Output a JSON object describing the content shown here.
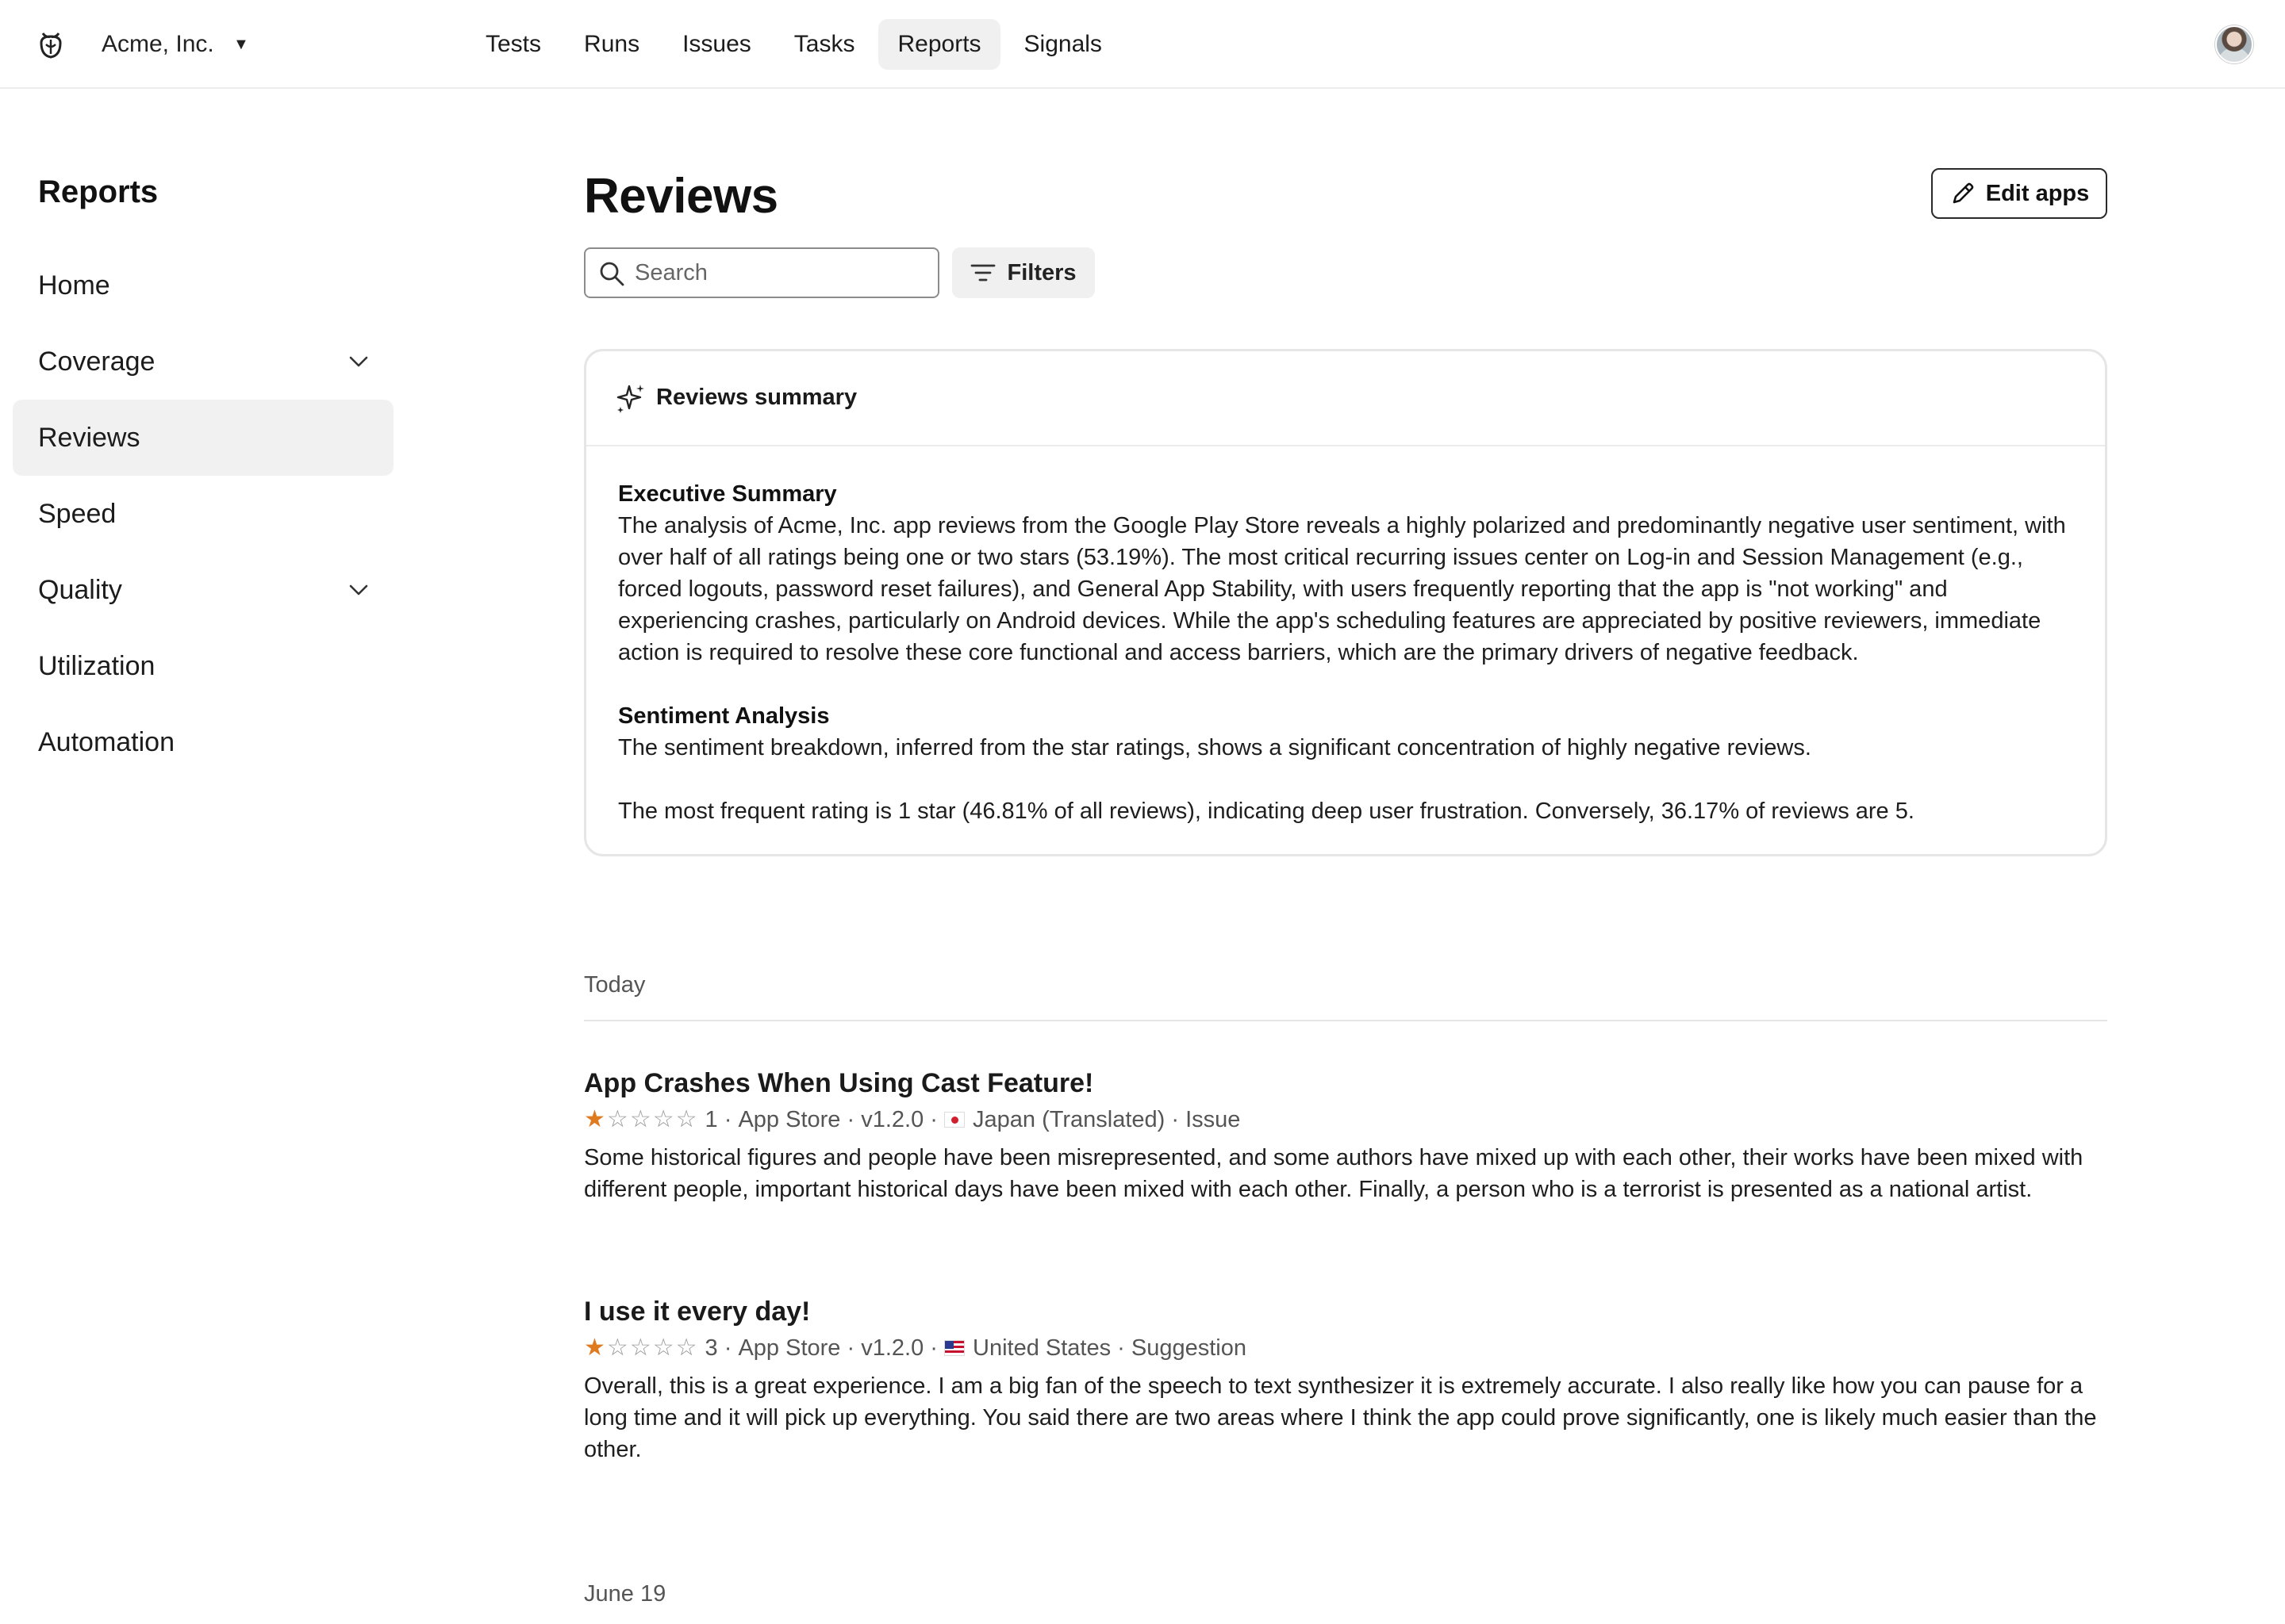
{
  "topbar": {
    "org_name": "Acme, Inc.",
    "nav": [
      {
        "label": "Tests",
        "active": false
      },
      {
        "label": "Runs",
        "active": false
      },
      {
        "label": "Issues",
        "active": false
      },
      {
        "label": "Tasks",
        "active": false
      },
      {
        "label": "Reports",
        "active": true
      },
      {
        "label": "Signals",
        "active": false
      }
    ]
  },
  "sidebar": {
    "title": "Reports",
    "items": [
      {
        "label": "Home",
        "expandable": false,
        "active": false
      },
      {
        "label": "Coverage",
        "expandable": true,
        "active": false
      },
      {
        "label": "Reviews",
        "expandable": false,
        "active": true
      },
      {
        "label": "Speed",
        "expandable": false,
        "active": false
      },
      {
        "label": "Quality",
        "expandable": true,
        "active": false
      },
      {
        "label": "Utilization",
        "expandable": false,
        "active": false
      },
      {
        "label": "Automation",
        "expandable": false,
        "active": false
      }
    ]
  },
  "main": {
    "title": "Reviews",
    "edit_apps_label": "Edit apps",
    "search_placeholder": "Search",
    "filters_label": "Filters",
    "summary": {
      "title": "Reviews summary",
      "exec_heading": "Executive Summary",
      "exec_text": "The analysis of Acme, Inc. app reviews from the Google Play Store reveals a highly polarized and predominantly negative user sentiment, with over half of all ratings being one or two stars (53.19%). The most critical recurring issues center on Log-in and Session Management (e.g., forced logouts, password reset failures), and General App Stability, with users frequently reporting that the app is \"not working\" and experiencing crashes, particularly on Android devices. While the app's scheduling features are appreciated by positive reviewers, immediate action is required to resolve these core functional and access barriers, which are the primary drivers of negative feedback.",
      "sentiment_heading": "Sentiment Analysis",
      "sentiment_text": "The sentiment breakdown, inferred from the star ratings, shows a significant concentration of highly negative reviews.",
      "frequency_text": "The most frequent rating is 1 star (46.81% of all reviews), indicating deep user frustration. Conversely, 36.17% of reviews are 5."
    },
    "groups": [
      {
        "label": "Today",
        "reviews": [
          {
            "title": "App Crashes When Using Cast Feature!",
            "stars_filled": 1,
            "rating": "1",
            "store": "App Store",
            "version": "v1.2.0",
            "country": "Japan (Translated)",
            "category": "Issue",
            "body": "Some historical figures and people have been misrepresented, and some authors have mixed up with each other, their works have been mixed with different people, important historical days have been mixed with each other. Finally, a person who is a terrorist is presented as a national artist."
          },
          {
            "title": "I use it every day!",
            "stars_filled": 1,
            "rating": "3",
            "store": "App Store",
            "version": "v1.2.0",
            "country": "United States",
            "category": "Suggestion",
            "body": "Overall, this is a great experience. I am a big fan of the speech to text synthesizer it is extremely accurate. I also really like how you can pause for a long time and it will pick up everything. You said there are two areas where I think the app could prove significantly, one is likely much easier than the other."
          }
        ]
      },
      {
        "label": "June 19",
        "reviews": []
      }
    ]
  }
}
